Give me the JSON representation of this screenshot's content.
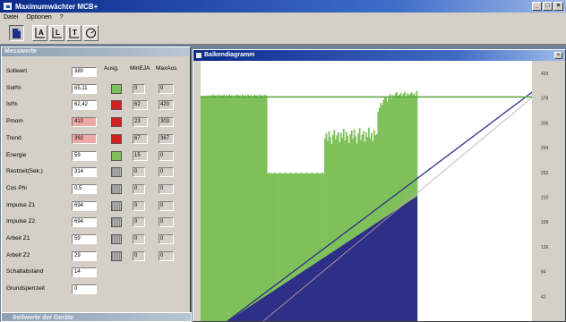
{
  "window": {
    "title": "Maximumwächter MCB+"
  },
  "window_buttons": [
    "_",
    "□",
    "×"
  ],
  "menu": [
    "Datei",
    "Optionen",
    "?"
  ],
  "toolbar": [
    {
      "icon": "document-icon",
      "label": ""
    },
    {
      "icon": "chart-a-icon",
      "label": "A"
    },
    {
      "icon": "chart-l-icon",
      "label": "L"
    },
    {
      "icon": "chart-t-icon",
      "label": "T"
    },
    {
      "icon": "gauge-icon",
      "label": ""
    }
  ],
  "messwerte": {
    "title": "Messwerte",
    "columns": {
      "ausg": "Ausg.",
      "min": "MinEJA",
      "max": "MaxAus"
    },
    "rows": [
      {
        "label": "Sollwert",
        "value": "380",
        "ausg": "",
        "min": "",
        "max": "",
        "warn": false
      },
      {
        "label": "Soll%",
        "value": "65,11",
        "ausg": "green",
        "min": "0",
        "max": "0",
        "warn": false
      },
      {
        "label": "Ist%",
        "value": "62,42",
        "ausg": "red",
        "min": "62",
        "max": "420",
        "warn": false
      },
      {
        "label": "Pmom",
        "value": "410",
        "ausg": "red",
        "min": "23",
        "max": "303",
        "warn": true
      },
      {
        "label": "Trend",
        "value": "392",
        "ausg": "red",
        "min": "67",
        "max": "367",
        "warn": true
      },
      {
        "label": "Energie",
        "value": "59",
        "ausg": "green",
        "min": "15",
        "max": "0",
        "warn": false
      },
      {
        "label": "Restzeit(Sek.)",
        "value": "314",
        "ausg": "gray",
        "min": "0",
        "max": "0",
        "warn": false
      },
      {
        "label": "Cos Phi",
        "value": "0,5",
        "ausg": "gray",
        "min": "0",
        "max": "0",
        "warn": false
      },
      {
        "label": "Impulse Z1",
        "value": "694",
        "ausg": "gray",
        "min": "0",
        "max": "0",
        "warn": false
      },
      {
        "label": "Impulse Z2",
        "value": "694",
        "ausg": "gray",
        "min": "0",
        "max": "0",
        "warn": false
      },
      {
        "label": "Arbeit Z1",
        "value": "59",
        "ausg": "gray",
        "min": "0",
        "max": "0",
        "warn": false
      },
      {
        "label": "Arbeit Z2",
        "value": "29",
        "ausg": "gray",
        "min": "0",
        "max": "0",
        "warn": false
      },
      {
        "label": "Schaltabstand",
        "value": "14",
        "ausg": "",
        "min": "",
        "max": "",
        "warn": false
      },
      {
        "label": "Grundsperrzeit",
        "value": "0",
        "ausg": "",
        "min": "",
        "max": "",
        "warn": false
      }
    ]
  },
  "second_window": {
    "title": "Sollwerte der Geräte"
  },
  "balken": {
    "title": "Balkendiagramm",
    "close_label": "×"
  },
  "chart_data": {
    "type": "bar",
    "title": "",
    "ylim": [
      0,
      420
    ],
    "ytick_labels": [
      "420",
      "378",
      "336",
      "294",
      "252",
      "210",
      "168",
      "126",
      "84",
      "42"
    ],
    "colors": {
      "bars": "#7ec05a",
      "energy_area": "#2e2f87",
      "trend_line": "#2e2f87",
      "setpoint_line": "#56a63a",
      "plot_bg": "#ffffff"
    },
    "bar_values": [
      382,
      382,
      380,
      382,
      381,
      383,
      381,
      383,
      382,
      384,
      382,
      383,
      381,
      384,
      382,
      383,
      382,
      384,
      381,
      383,
      382,
      384,
      382,
      383,
      381,
      382,
      383,
      384,
      382,
      383,
      381,
      384,
      382,
      383,
      381,
      384,
      382,
      383,
      381,
      382,
      384,
      382,
      383,
      381,
      384,
      382,
      383,
      381,
      384,
      382,
      250,
      252,
      250,
      251,
      250,
      252,
      250,
      251,
      250,
      252,
      250,
      251,
      250,
      252,
      250,
      251,
      250,
      252,
      250,
      251,
      250,
      252,
      250,
      251,
      250,
      252,
      250,
      251,
      250,
      252,
      250,
      251,
      250,
      252,
      250,
      251,
      250,
      252,
      250,
      251,
      250,
      252,
      250,
      310,
      318,
      305,
      322,
      312,
      300,
      316,
      324,
      308,
      315,
      320,
      303,
      319,
      311,
      326,
      306,
      321,
      314,
      302,
      317,
      323,
      309,
      325,
      313,
      301,
      318,
      327,
      307,
      316,
      322,
      304,
      320,
      312,
      328,
      310,
      319,
      305,
      324,
      315,
      317,
      355,
      362,
      370,
      366,
      375,
      380,
      378,
      372,
      381,
      385,
      377,
      383,
      379,
      386,
      388,
      382,
      384,
      387,
      380,
      386,
      389,
      381,
      386,
      383,
      385,
      388,
      384,
      386,
      382,
      390
    ],
    "energy_area_end": 212,
    "energy_area_x_end_bar": 163,
    "trend_line": {
      "y_start": 0,
      "y_end": 388
    },
    "setpoint": 380
  }
}
